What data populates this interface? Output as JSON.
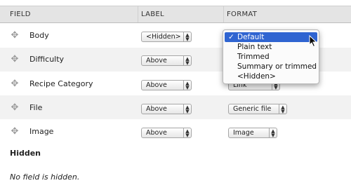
{
  "columns": {
    "field": "FIELD",
    "label": "LABEL",
    "format": "FORMAT"
  },
  "rows": [
    {
      "name": "Body",
      "label_value": "<Hidden>",
      "format_value": "Default"
    },
    {
      "name": "Difficulty",
      "label_value": "Above",
      "format_value": ""
    },
    {
      "name": "Recipe Category",
      "label_value": "Above",
      "format_value": "Link"
    },
    {
      "name": "File",
      "label_value": "Above",
      "format_value": "Generic file"
    },
    {
      "name": "Image",
      "label_value": "Above",
      "format_value": "Image"
    }
  ],
  "format_dropdown": {
    "options": [
      "Default",
      "Plain text",
      "Trimmed",
      "Summary or trimmed",
      "<Hidden>"
    ],
    "selected": "Default",
    "check_mark": "✓"
  },
  "hidden_section": {
    "title": "Hidden",
    "note": "No field is hidden."
  },
  "icons": {
    "drag": "drag-handle-icon",
    "select_arrows": "updown-arrows-icon",
    "cursor": "mouse-cursor-icon"
  },
  "colors": {
    "header_bg": "#e4e4e4",
    "row_alt_bg": "#f2f2f2",
    "selected_option_bg": "#2f64d1"
  }
}
